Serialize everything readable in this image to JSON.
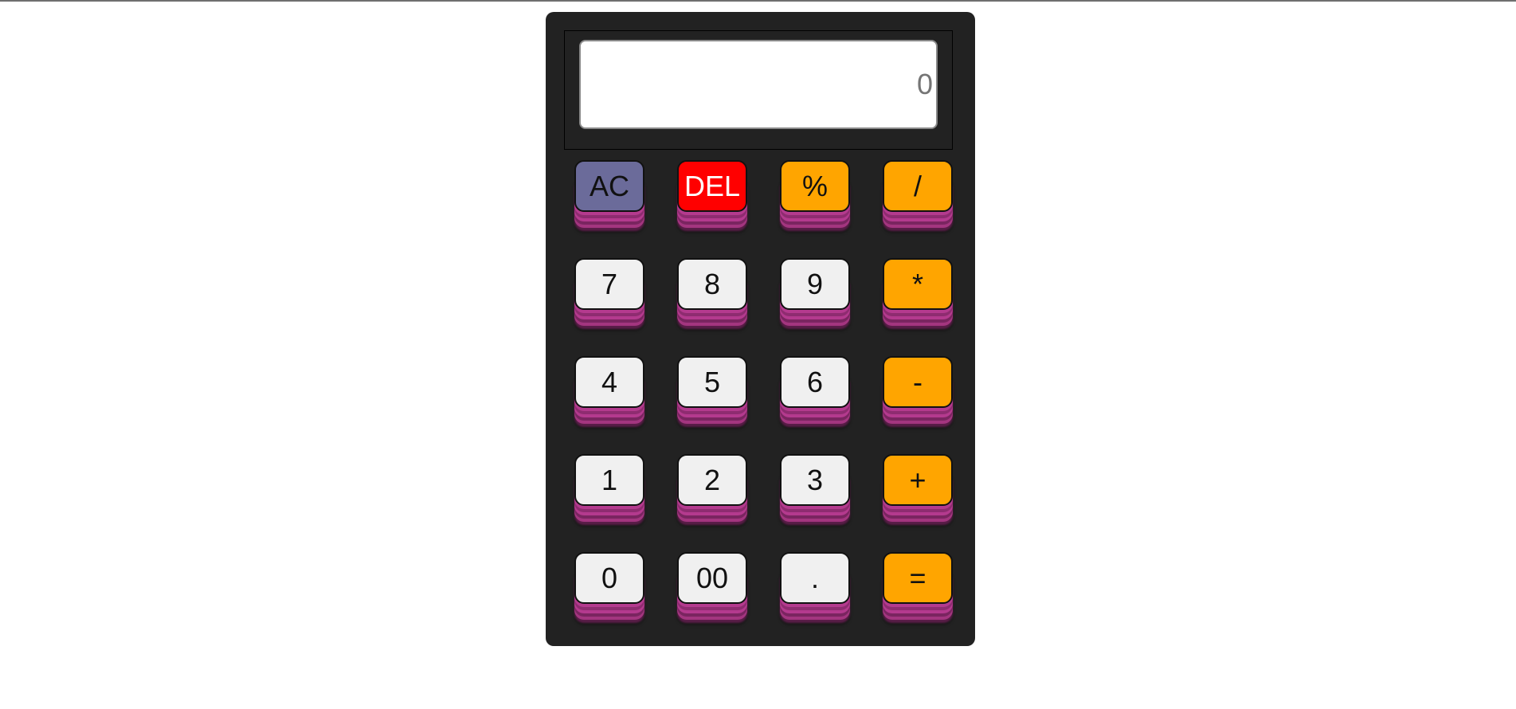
{
  "display": {
    "placeholder": "0"
  },
  "colors": {
    "body": "#222222",
    "number_key": "#f0f0f0",
    "operator_key": "#ffa500",
    "clear_key": "#6b6b9a",
    "delete_key": "#ff0000",
    "key_shadow": "#b43a8e"
  },
  "keys": {
    "ac": "AC",
    "del": "DEL",
    "percent": "%",
    "divide": "/",
    "seven": "7",
    "eight": "8",
    "nine": "9",
    "multiply": "*",
    "four": "4",
    "five": "5",
    "six": "6",
    "subtract": "-",
    "one": "1",
    "two": "2",
    "three": "3",
    "add": "+",
    "zero": "0",
    "double_zero": "00",
    "decimal": ".",
    "equals": "="
  }
}
